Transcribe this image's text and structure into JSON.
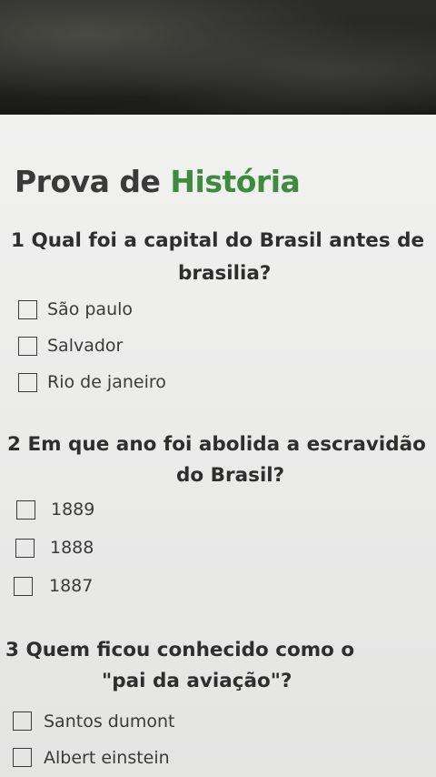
{
  "exam": {
    "title_part1": "Prova de",
    "title_part2": "História",
    "accent_color": "#3f8a3f",
    "questions": [
      {
        "number": "1",
        "line1": "Qual foi a capital do Brasil antes de",
        "line2": "brasilia?",
        "options": [
          "São paulo",
          "Salvador",
          "Rio de janeiro"
        ]
      },
      {
        "number": "2",
        "line1": "Em que ano foi abolida a escravidão",
        "line2": "do Brasil?",
        "options": [
          "1889",
          "1888",
          "1887"
        ]
      },
      {
        "number": "3",
        "line1": "Quem ficou conhecido como o",
        "line2": "\"pai da aviação\"?",
        "options": [
          "Santos dumont",
          "Albert einstein"
        ]
      }
    ]
  }
}
